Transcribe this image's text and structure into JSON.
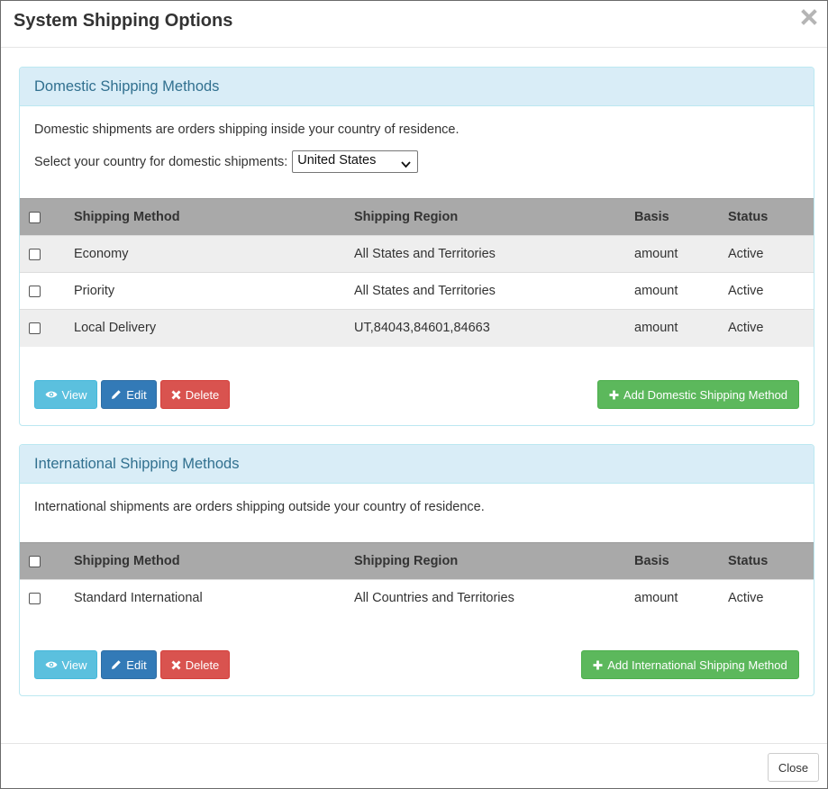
{
  "modal": {
    "title": "System Shipping Options",
    "close_label": "Close"
  },
  "domestic": {
    "heading": "Domestic Shipping Methods",
    "description": "Domestic shipments are orders shipping inside your country of residence.",
    "country_label": "Select your country for domestic shipments:",
    "country_selected": "United States",
    "columns": [
      "Shipping Method",
      "Shipping Region",
      "Basis",
      "Status"
    ],
    "rows": [
      {
        "method": "Economy",
        "region": "All States and Territories",
        "basis": "amount",
        "status": "Active"
      },
      {
        "method": "Priority",
        "region": "All States and Territories",
        "basis": "amount",
        "status": "Active"
      },
      {
        "method": "Local Delivery",
        "region": "UT,84043,84601,84663",
        "basis": "amount",
        "status": "Active"
      }
    ],
    "buttons": {
      "view": "View",
      "edit": "Edit",
      "delete": "Delete",
      "add": "Add Domestic Shipping Method"
    }
  },
  "international": {
    "heading": "International Shipping Methods",
    "description": "International shipments are orders shipping outside your country of residence.",
    "columns": [
      "Shipping Method",
      "Shipping Region",
      "Basis",
      "Status"
    ],
    "rows": [
      {
        "method": "Standard International",
        "region": "All Countries and Territories",
        "basis": "amount",
        "status": "Active"
      }
    ],
    "buttons": {
      "view": "View",
      "edit": "Edit",
      "delete": "Delete",
      "add": "Add International Shipping Method"
    }
  },
  "icons": {
    "close": "close-icon",
    "view": "eye-icon",
    "edit": "pencil-icon",
    "delete": "x-icon",
    "add": "plus-icon",
    "select": "chevron-down-icon"
  },
  "colors": {
    "panel_heading_bg": "#d9edf7",
    "panel_heading_text": "#31708f",
    "table_header_bg": "#a9a9a9",
    "status_active": "#3c8d3c",
    "btn_info": "#5bc0de",
    "btn_primary": "#337ab7",
    "btn_danger": "#d9534f",
    "btn_success": "#5cb85c"
  }
}
